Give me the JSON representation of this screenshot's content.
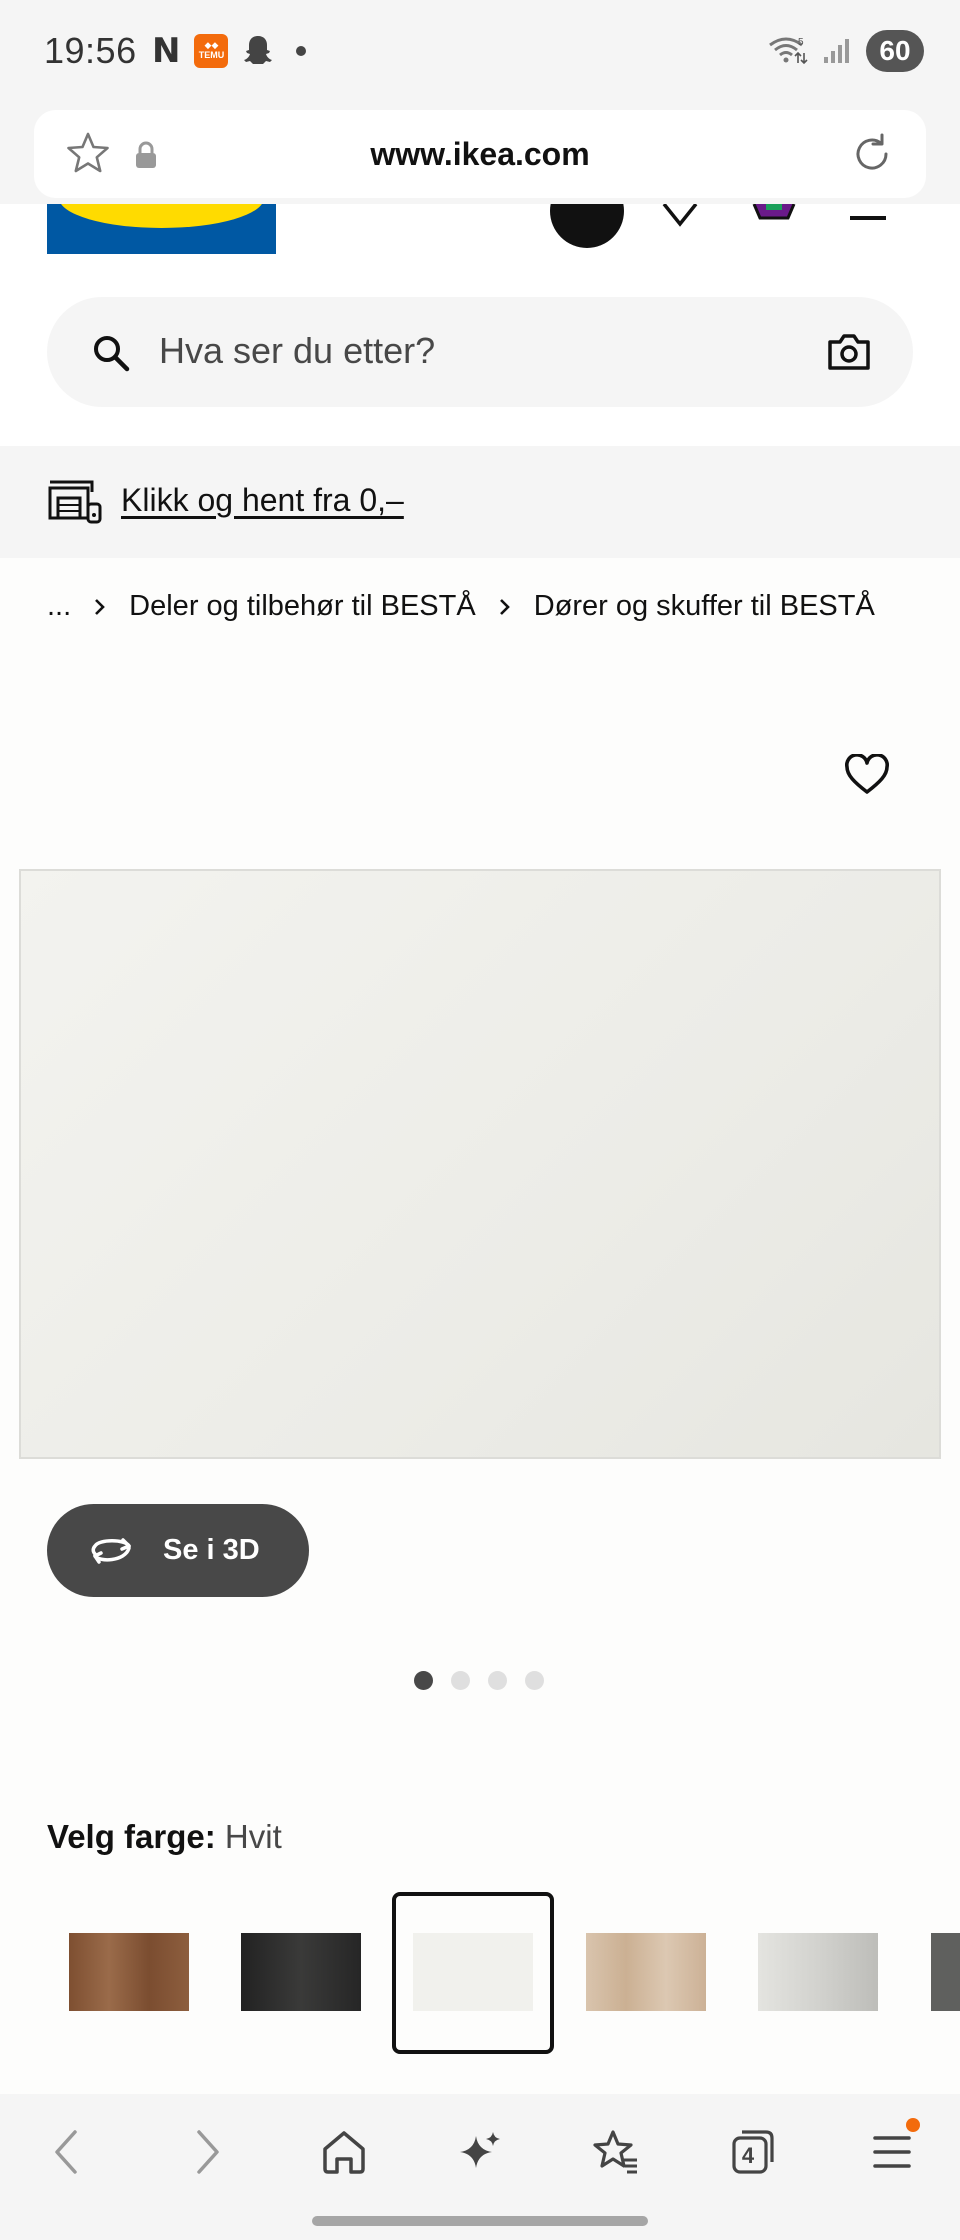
{
  "status_bar": {
    "time": "19:56",
    "battery": "60",
    "left_icons": [
      "netflix-icon",
      "temu-icon",
      "snapchat-icon",
      "notification-dot"
    ],
    "right_icons": [
      "wifi-icon",
      "signal-icon",
      "battery-icon"
    ]
  },
  "browser": {
    "url": "www.ikea.com",
    "tab_count": "4"
  },
  "search": {
    "placeholder": "Hva ser du etter?"
  },
  "banner": {
    "link_text": "Klikk og hent fra 0,–"
  },
  "breadcrumb": {
    "items": [
      "...",
      "Deler og tilbehør til BESTÅ",
      "Dører og skuffer til BESTÅ"
    ]
  },
  "product": {
    "view_3d_label": "Se i 3D",
    "image_count": 4,
    "active_image_index": 0
  },
  "color_selection": {
    "label": "Velg farge:",
    "selected_value": "Hvit",
    "swatches": [
      {
        "color": "#8a5a3a",
        "selected": false
      },
      {
        "color": "#2b2b2a",
        "selected": false
      },
      {
        "color": "#f3f3ef",
        "selected": true
      },
      {
        "color": "#d6c0a8",
        "selected": false
      },
      {
        "color": "#d9d9d5",
        "selected": false
      },
      {
        "color": "#5f605e",
        "selected": false
      }
    ]
  },
  "colors": {
    "ikea_blue": "#0058a3",
    "ikea_yellow": "#ffdb00",
    "dark_button": "#484848"
  }
}
